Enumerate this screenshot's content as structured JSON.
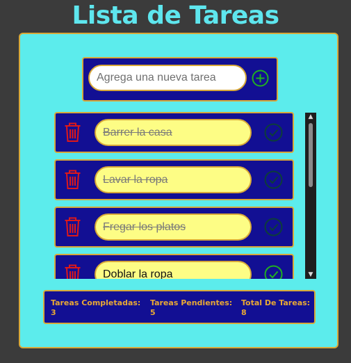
{
  "app": {
    "title": "Lista de Tareas"
  },
  "new_task": {
    "placeholder": "Agrega una nueva tarea",
    "value": "",
    "add_icon": "plus-circle-icon"
  },
  "tasks": [
    {
      "text": "Barrer la casa",
      "completed": true
    },
    {
      "text": "Lavar la ropa",
      "completed": true
    },
    {
      "text": "Fregar los platos",
      "completed": true
    },
    {
      "text": "Doblar la ropa",
      "completed": false
    }
  ],
  "task_icons": {
    "delete": "trash-icon",
    "complete": "check-circle-icon"
  },
  "scrollbar": {
    "up_arrow": "▲",
    "down_arrow": "▼"
  },
  "stats": {
    "completed_label": "Tareas Completadas:",
    "completed_value": "3",
    "pending_label": "Tareas Pendientes:",
    "pending_value": "5",
    "total_label": "Total De Tareas:",
    "total_value": "8"
  },
  "colors": {
    "background": "#3b3b3b",
    "title": "#5ee6ee",
    "panel": "#5cecec",
    "card": "#120f93",
    "border": "#d8a838",
    "task_field": "#fdfd85",
    "delete": "#e01818",
    "check_done": "#0d3d3a",
    "check_pending": "#20b020",
    "stat_text": "#e8a834"
  }
}
